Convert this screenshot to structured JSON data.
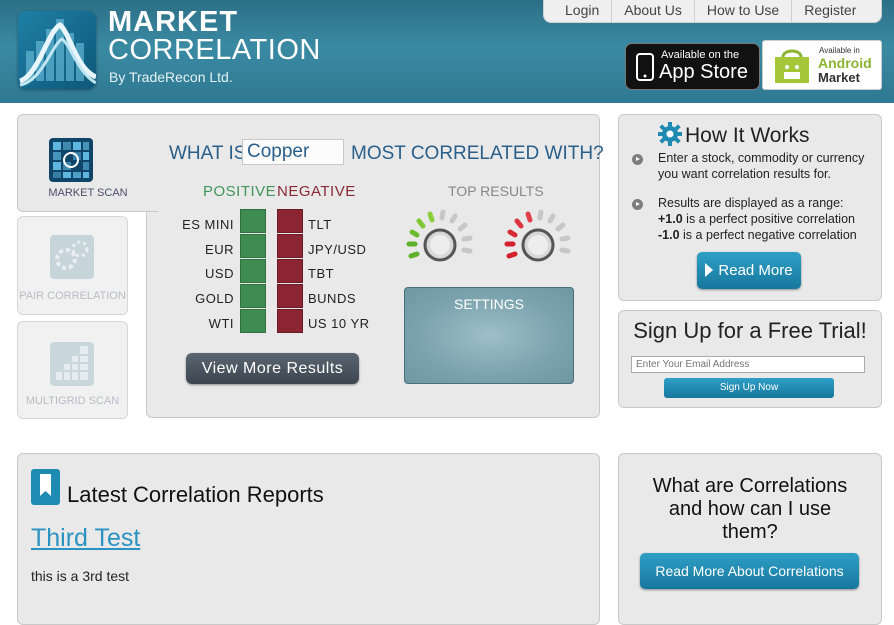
{
  "header": {
    "brand_line1": "MARKET",
    "brand_line2": "CORRELATION",
    "brand_line3": "By TradeRecon Ltd.",
    "nav": [
      "Login",
      "About Us",
      "How to Use",
      "Register"
    ],
    "appstore_small": "Available on the",
    "appstore_big": "App Store",
    "android_small": "Available in",
    "android_mid": "Android",
    "android_big": "Market"
  },
  "tabs": {
    "market_scan": "MARKET SCAN",
    "pair_correlation": "PAIR CORRELATION",
    "multigrid_scan": "MULTIGRID SCAN"
  },
  "scanner": {
    "what_is": "WHAT IS",
    "input_value": "Copper",
    "most_correlated": "MOST CORRELATED WITH?",
    "positive_heading": "POSITIVE",
    "negative_heading": "NEGATIVE",
    "positive": [
      "ES MINI",
      "EUR",
      "USD",
      "GOLD",
      "WTI"
    ],
    "negative": [
      "TLT",
      "JPY/USD",
      "TBT",
      "BUNDS",
      "US 10 YR"
    ],
    "view_more": "View More Results",
    "top_results": "TOP RESULTS",
    "settings": "SETTINGS"
  },
  "how_it_works": {
    "title": "How It Works",
    "point1_l1": "Enter a stock, commodity or currency",
    "point1_l2": "you want correlation results for.",
    "point2_l1": "Results are displayed as a range:",
    "point2_l2_bold": "+1.0",
    "point2_l2": " is a perfect positive correlation",
    "point2_l3_bold": "-1.0",
    "point2_l3": " is a perfect negative correlation",
    "read_more": "Read More"
  },
  "signup": {
    "title": "Sign Up for a Free Trial!",
    "email_placeholder": "Enter Your Email Address",
    "button": "Sign Up Now"
  },
  "reports": {
    "title": "Latest Correlation Reports",
    "post_title": "Third Test",
    "post_body": "this is a 3rd test"
  },
  "correlations": {
    "title_l1": "What are Correlations",
    "title_l2": "and how can I use",
    "title_l3": "them?",
    "button": "Read More About Correlations"
  },
  "colors": {
    "header_teal": "#2f7891",
    "positive_green": "#3e8c52",
    "negative_red": "#8c2532",
    "button_blue": "#1f8bb2",
    "link_blue": "#2a93c2"
  }
}
